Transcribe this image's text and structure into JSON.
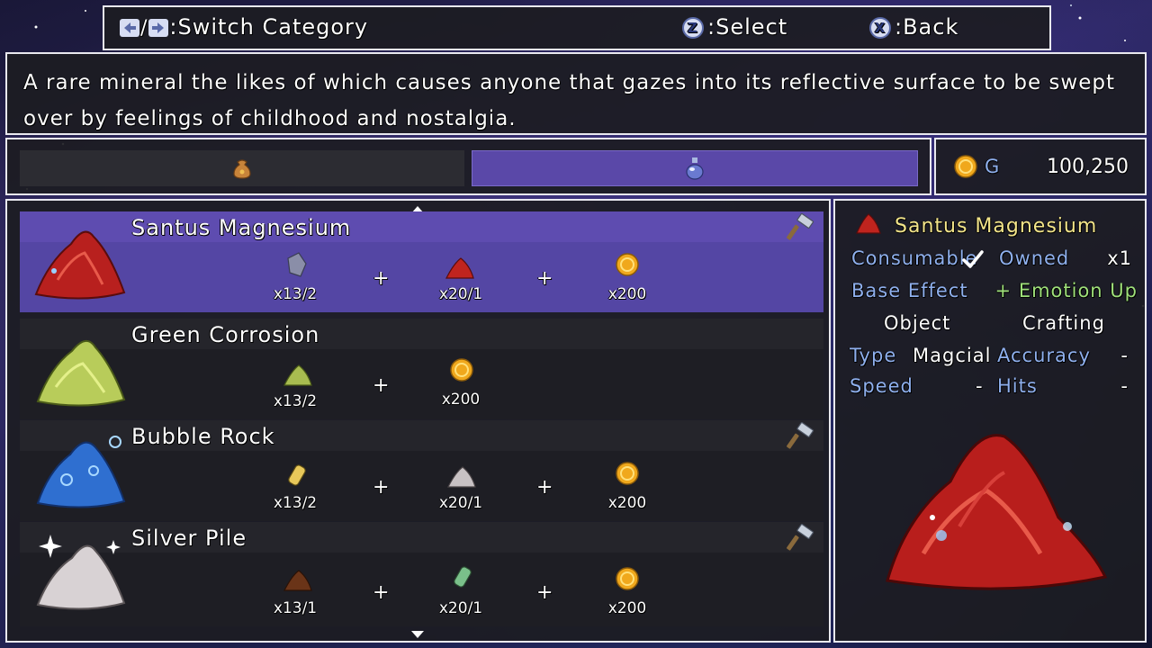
{
  "controls": {
    "switch_label": ":Switch Category",
    "select_key": "Z",
    "select_label": ":Select",
    "back_key": "X",
    "back_label": ":Back"
  },
  "description": "A rare mineral the likes of which causes anyone that gazes into its reflective surface to be swept over by feelings of childhood and nostalgia.",
  "categories": [
    {
      "icon": "pouch-icon",
      "active": false
    },
    {
      "icon": "potion-flask-icon",
      "active": true
    }
  ],
  "gold": {
    "label": "G",
    "amount": "100,250"
  },
  "items": [
    {
      "name": "Santus Magnesium",
      "icon": "red-ore-icon",
      "craftable": true,
      "selected": true,
      "ingredients": [
        {
          "icon": "gray-crystal-icon",
          "qty": "x13/2"
        },
        {
          "icon": "red-ore-icon",
          "qty": "x20/1"
        },
        {
          "icon": "gold-coin-icon",
          "qty": "x200"
        }
      ]
    },
    {
      "name": "Green Corrosion",
      "icon": "green-ore-icon",
      "craftable": false,
      "selected": false,
      "ingredients": [
        {
          "icon": "green-ore-icon",
          "qty": "x13/2"
        },
        {
          "icon": "gold-coin-icon",
          "qty": "x200"
        }
      ]
    },
    {
      "name": "Bubble Rock",
      "icon": "blue-ore-icon",
      "craftable": true,
      "selected": false,
      "ingredients": [
        {
          "icon": "yellow-vial-icon",
          "qty": "x13/2"
        },
        {
          "icon": "silver-ore-icon",
          "qty": "x20/1"
        },
        {
          "icon": "gold-coin-icon",
          "qty": "x200"
        }
      ]
    },
    {
      "name": "Silver Pile",
      "icon": "silver-ore-icon",
      "craftable": true,
      "selected": false,
      "ingredients": [
        {
          "icon": "brown-ore-icon",
          "qty": "x13/1"
        },
        {
          "icon": "green-vial-icon",
          "qty": "x20/1"
        },
        {
          "icon": "gold-coin-icon",
          "qty": "x200"
        }
      ]
    }
  ],
  "detail": {
    "name": "Santus Magnesium",
    "consumable_label": "Consumable",
    "owned_label": "Owned",
    "owned_value": "x1",
    "base_effect_label": "Base Effect",
    "base_effect_value": "+ Emotion Up",
    "object_label": "Object",
    "crafting_label": "Crafting",
    "type_label": "Type",
    "type_value": "Magcial",
    "accuracy_label": "Accuracy",
    "accuracy_value": "-",
    "speed_label": "Speed",
    "speed_value": "-",
    "hits_label": "Hits",
    "hits_value": "-"
  },
  "colors": {
    "selected_row": "#5e4cb0",
    "active_tab": "#5a48a8",
    "label_blue": "#8fb0ee",
    "effect_green": "#9fe07a",
    "title_yellow": "#f3e58a"
  }
}
